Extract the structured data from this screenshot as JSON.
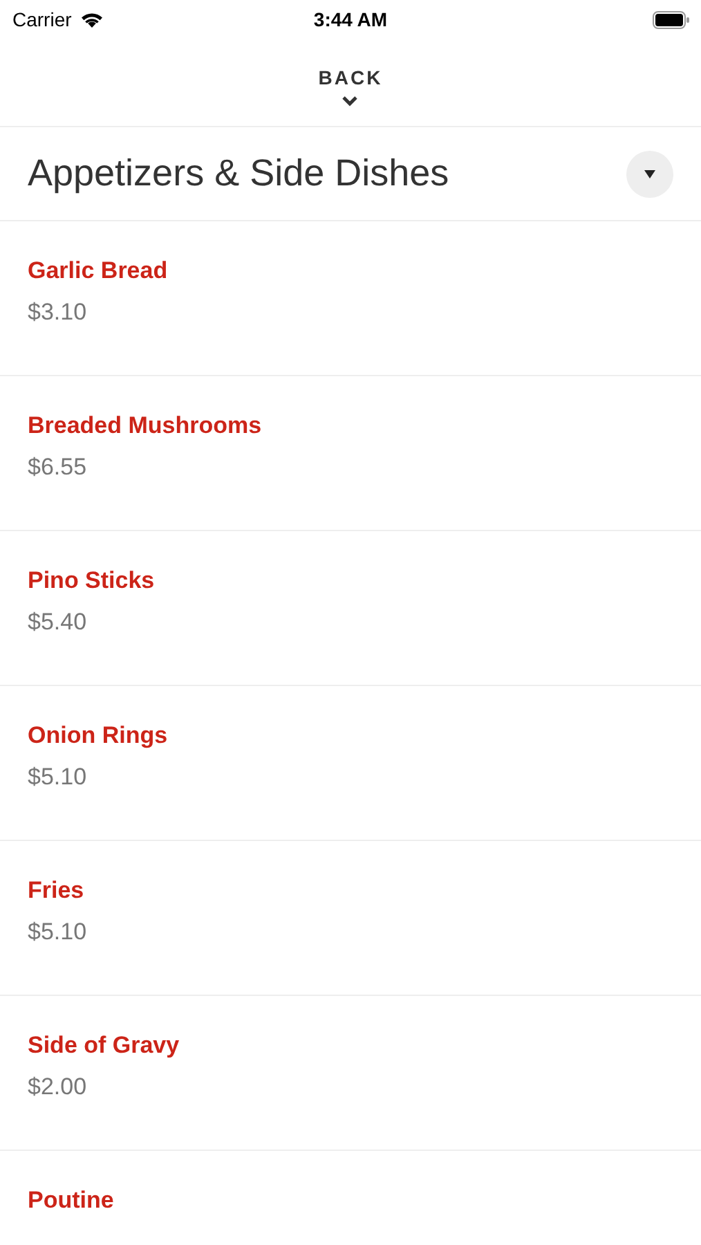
{
  "status_bar": {
    "carrier": "Carrier",
    "time": "3:44 AM"
  },
  "nav": {
    "back": "BACK"
  },
  "category": {
    "title": "Appetizers & Side Dishes"
  },
  "items": [
    {
      "name": "Garlic Bread",
      "price": "$3.10"
    },
    {
      "name": "Breaded Mushrooms",
      "price": "$6.55"
    },
    {
      "name": "Pino Sticks",
      "price": "$5.40"
    },
    {
      "name": "Onion Rings",
      "price": "$5.10"
    },
    {
      "name": "Fries",
      "price": "$5.10"
    },
    {
      "name": "Side of Gravy",
      "price": "$2.00"
    },
    {
      "name": "Poutine"
    }
  ]
}
